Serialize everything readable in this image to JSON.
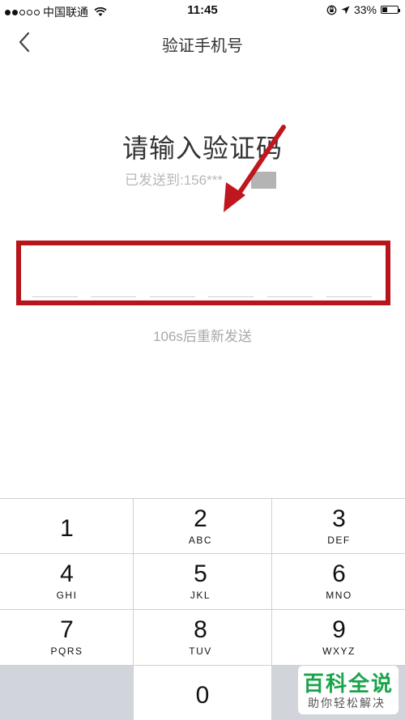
{
  "status_bar": {
    "carrier": "中国联通",
    "time": "11:45",
    "battery_percent": "33%",
    "battery_level": 0.33,
    "icons": [
      "signal-dots-icon",
      "wifi-icon",
      "orientation-lock-icon",
      "location-arrow-icon",
      "battery-icon"
    ]
  },
  "nav": {
    "title": "验证手机号",
    "back_icon": "chevron-left-icon"
  },
  "verify": {
    "title": "请输入验证码",
    "sent_to": "已发送到:156***",
    "code_slots": [
      "",
      "",
      "",
      "",
      "",
      ""
    ],
    "resend": "106s后重新发送"
  },
  "keypad": {
    "keys": [
      {
        "digit": "1",
        "letters": ""
      },
      {
        "digit": "2",
        "letters": "ABC"
      },
      {
        "digit": "3",
        "letters": "DEF"
      },
      {
        "digit": "4",
        "letters": "GHI"
      },
      {
        "digit": "5",
        "letters": "JKL"
      },
      {
        "digit": "6",
        "letters": "MNO"
      },
      {
        "digit": "7",
        "letters": "PQRS"
      },
      {
        "digit": "8",
        "letters": "TUV"
      },
      {
        "digit": "9",
        "letters": "WXYZ"
      },
      {
        "digit": "0",
        "letters": ""
      }
    ]
  },
  "annotation": {
    "highlight_color": "#b8141c",
    "arrow_color": "#c0161e"
  },
  "watermark": {
    "title": "百科全说",
    "subtitle": "助你轻松解决"
  }
}
